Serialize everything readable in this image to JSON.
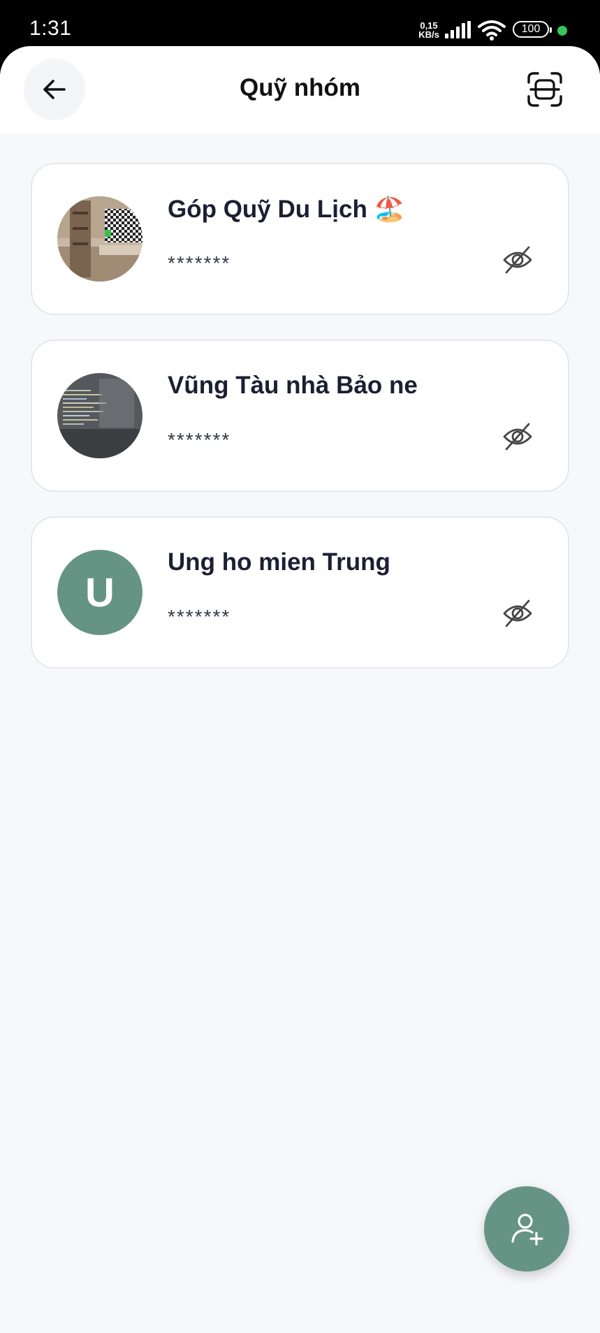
{
  "status_bar": {
    "time": "1:31",
    "speed_value": "0,15",
    "speed_unit": "KB/s",
    "battery": "100"
  },
  "header": {
    "title": "Quỹ nhóm",
    "back_icon": "arrow-left-icon",
    "scan_icon": "scan-qr-icon"
  },
  "funds": [
    {
      "name": "Góp Quỹ Du Lịch 🏖️",
      "balance": "*******",
      "avatar": "photo-room"
    },
    {
      "name": "Vũng Tàu nhà Bảo ne",
      "balance": "*******",
      "avatar": "photo-code-screen"
    },
    {
      "name": "Ung ho mien Trung",
      "balance": "*******",
      "avatar_letter": "U"
    }
  ],
  "colors": {
    "accent": "#659484",
    "background": "#f7f8fa",
    "card": "#ffffff",
    "text_primary": "#1b1f33"
  },
  "fab": {
    "icon": "add-member-icon"
  }
}
